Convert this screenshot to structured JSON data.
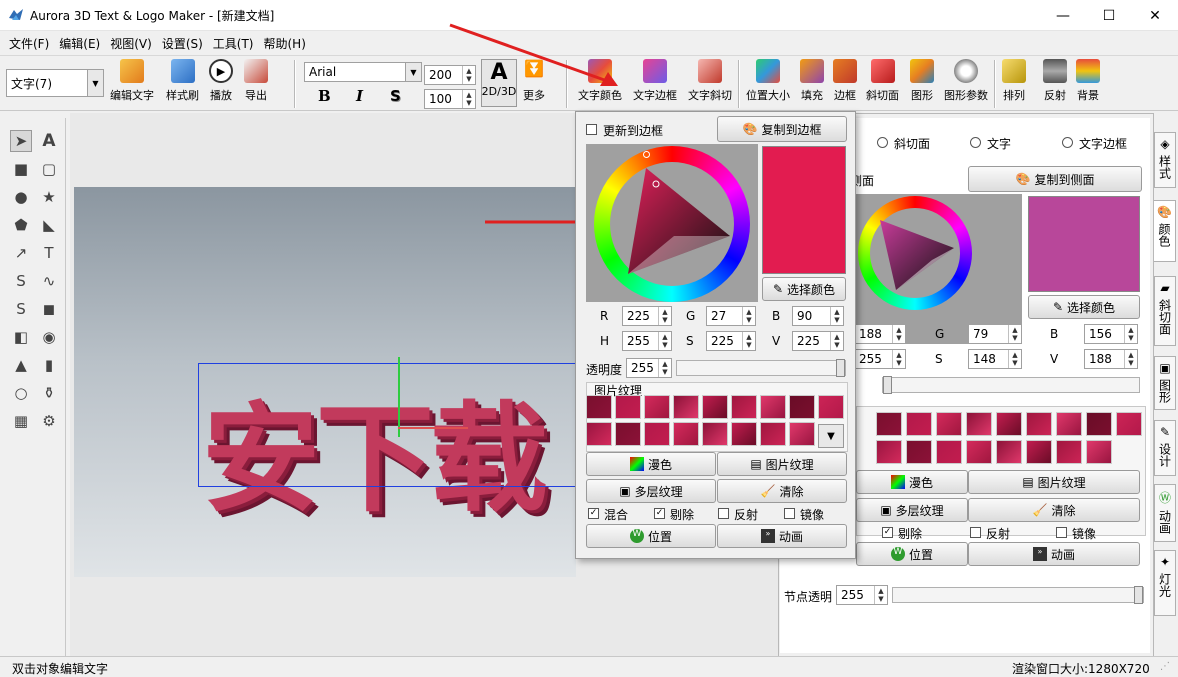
{
  "window": {
    "title": "Aurora 3D Text & Logo Maker - [新建文档]",
    "minimize": "—",
    "maximize": "☐",
    "close": "✕"
  },
  "menu": [
    "文件(F)",
    "编辑(E)",
    "视图(V)",
    "设置(S)",
    "工具(T)",
    "帮助(H)"
  ],
  "toolbar": {
    "object_select": "文字(7)",
    "edit_text": "编辑文字",
    "style_brush": "样式刷",
    "play": "播放",
    "export": "导出",
    "font": "Arial",
    "size1": "200",
    "size2": "100",
    "bold": "B",
    "italic": "I",
    "shadow": "S",
    "mode_glyph": "A",
    "mode": "2D/3D",
    "more": "更多",
    "text_color": "文字颜色",
    "text_border": "文字边框",
    "text_bevel": "文字斜切",
    "position_size": "位置大小",
    "fill": "填充",
    "border": "边框",
    "bevel": "斜切面",
    "shape": "图形",
    "shape_params": "图形参数",
    "arrange": "排列",
    "reflect": "反射",
    "background": "背景"
  },
  "canvas": {
    "text": "安下载"
  },
  "popup": {
    "update_border_label": "更新到边框",
    "copy_to_border": "复制到边框",
    "select_color": "选择颜色",
    "swatch_color": "#e21c50",
    "R_label": "R",
    "R": "225",
    "G_label": "G",
    "G": "27",
    "B_label": "B",
    "B": "90",
    "H_label": "H",
    "H": "255",
    "S_label": "S",
    "S": "225",
    "V_label": "V",
    "V": "225",
    "opacity_label": "透明度",
    "opacity": "255",
    "texture_group": "图片纹理",
    "diffuse": "漫色",
    "image_texture": "图片纹理",
    "multi_texture": "多层纹理",
    "clear": "清除",
    "blend": "混合",
    "cull": "剔除",
    "reflect": "反射",
    "mirror": "镜像",
    "position": "位置",
    "animation": "动画"
  },
  "panel": {
    "radio_bevel": "斜切面",
    "radio_text": "文字",
    "radio_text_border": "文字边框",
    "side_label": "侧面",
    "copy_to_side": "复制到侧面",
    "swatch_color": "#b8479a",
    "select_color": "选择颜色",
    "R": "188",
    "G_label": "G",
    "G": "79",
    "B_label": "B",
    "B": "156",
    "H": "255",
    "S_label": "S",
    "S": "148",
    "V_label": "V",
    "V": "188",
    "diffuse": "漫色",
    "image_texture": "图片纹理",
    "multi_texture": "多层纹理",
    "clear": "清除",
    "cull": "剔除",
    "reflect": "反射",
    "mirror": "镜像",
    "position": "位置",
    "animation": "动画",
    "node_opacity_label": "节点透明",
    "node_opacity": "255"
  },
  "side_tabs": [
    "样式",
    "颜色",
    "斜切面",
    "图形",
    "设计",
    "动画",
    "灯光"
  ],
  "status": {
    "left": "双击对象编辑文字",
    "right": "渲染窗口大小:1280X720"
  }
}
